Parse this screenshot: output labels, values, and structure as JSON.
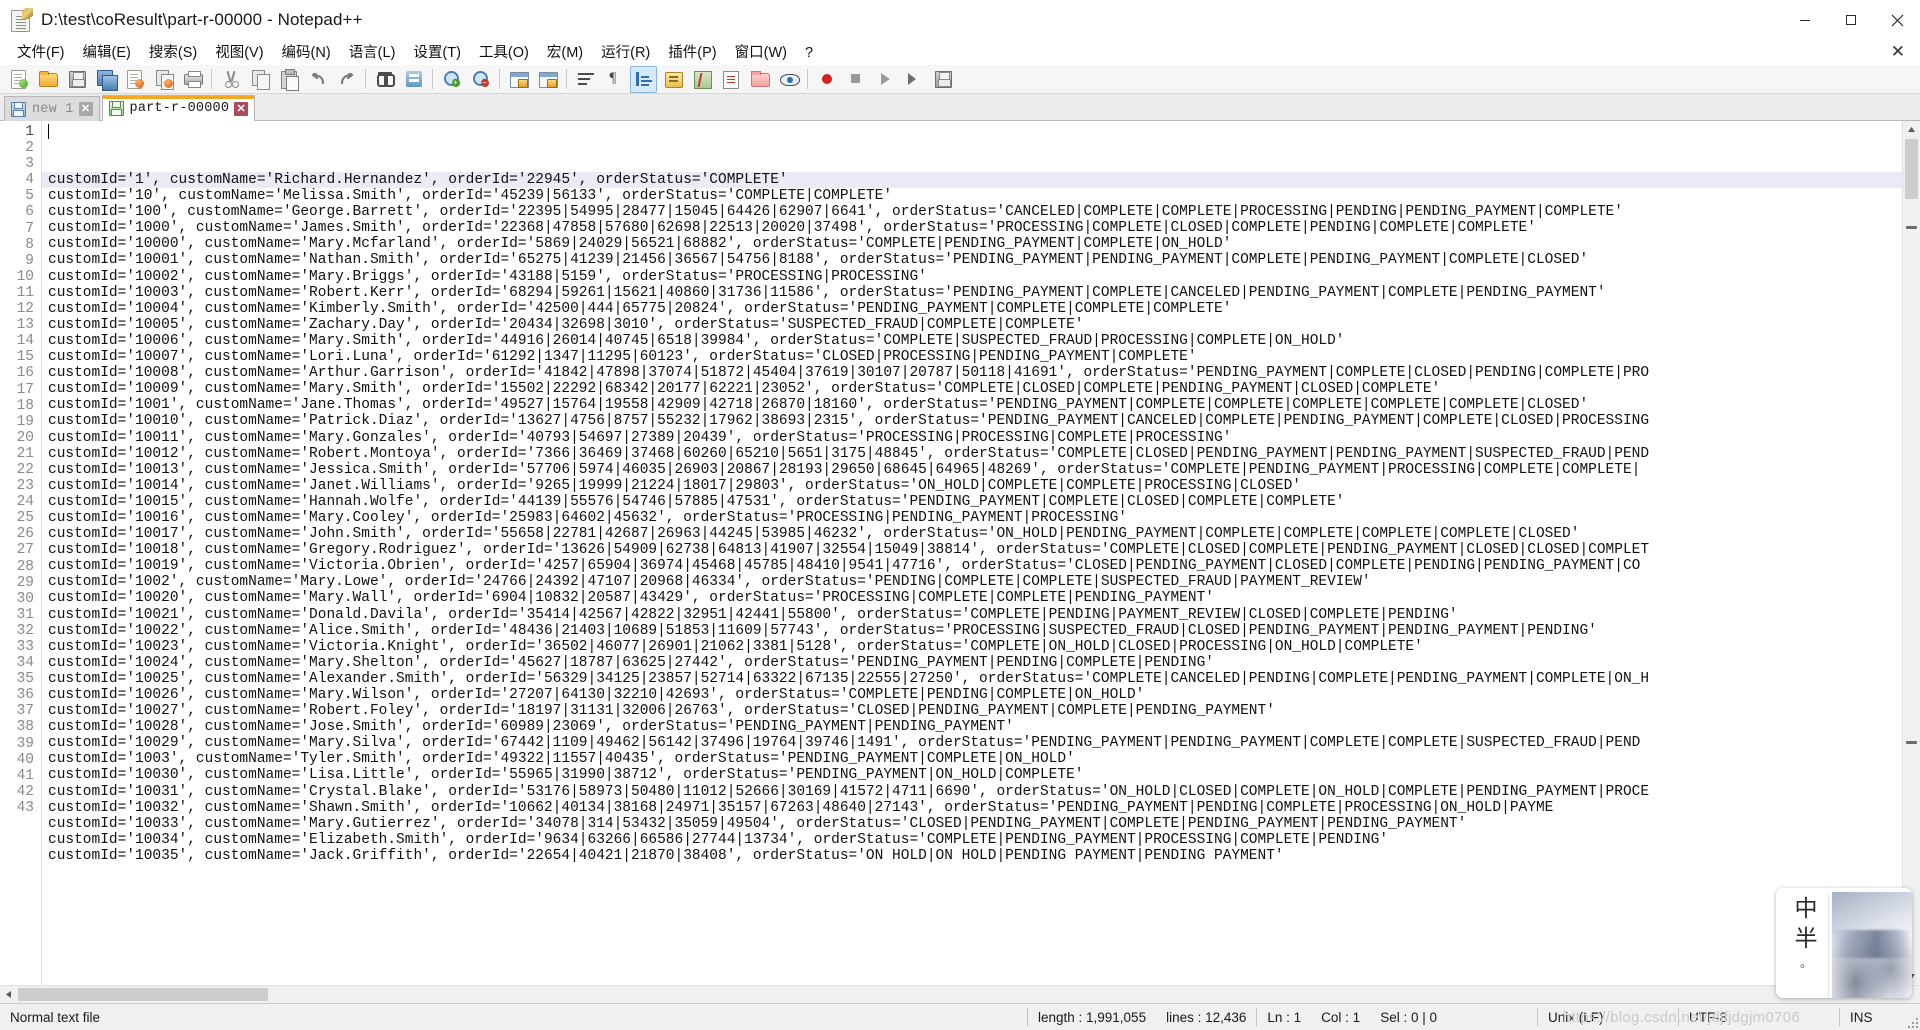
{
  "window": {
    "title": "D:\\test\\coResult\\part-r-00000 - Notepad++",
    "icon": "notepad-plus-plus-icon",
    "minimize_label": "–",
    "maximize_label": "☐",
    "close_label": "✕"
  },
  "menu": {
    "items": [
      {
        "label": "文件(F)",
        "name": "file"
      },
      {
        "label": "编辑(E)",
        "name": "edit"
      },
      {
        "label": "搜索(S)",
        "name": "search"
      },
      {
        "label": "视图(V)",
        "name": "view"
      },
      {
        "label": "编码(N)",
        "name": "encoding"
      },
      {
        "label": "语言(L)",
        "name": "language"
      },
      {
        "label": "设置(T)",
        "name": "settings"
      },
      {
        "label": "工具(O)",
        "name": "tools"
      },
      {
        "label": "宏(M)",
        "name": "macro"
      },
      {
        "label": "运行(R)",
        "name": "run"
      },
      {
        "label": "插件(P)",
        "name": "plugins"
      },
      {
        "label": "窗口(W)",
        "name": "window"
      },
      {
        "label": "?",
        "name": "help"
      }
    ],
    "close_document_label": "✕"
  },
  "toolbar": {
    "buttons": [
      {
        "name": "new-file-icon",
        "title": "新建"
      },
      {
        "name": "open-file-icon",
        "title": "打开"
      },
      {
        "name": "save-icon",
        "title": "保存"
      },
      {
        "name": "save-all-icon",
        "title": "全部保存"
      },
      {
        "name": "close-file-icon",
        "title": "关闭"
      },
      {
        "name": "close-all-icon",
        "title": "全部关闭"
      },
      {
        "name": "print-icon",
        "title": "打印"
      },
      {
        "name": "cut-icon",
        "title": "剪切"
      },
      {
        "name": "copy-icon",
        "title": "复制"
      },
      {
        "name": "paste-icon",
        "title": "粘贴"
      },
      {
        "name": "undo-icon",
        "title": "撤销"
      },
      {
        "name": "redo-icon",
        "title": "重做"
      },
      {
        "name": "find-icon",
        "title": "查找"
      },
      {
        "name": "replace-icon",
        "title": "替换"
      },
      {
        "name": "zoom-in-icon",
        "title": "放大"
      },
      {
        "name": "zoom-out-icon",
        "title": "缩小"
      },
      {
        "name": "sync-vertical-scroll-icon",
        "title": "同步垂直滚动"
      },
      {
        "name": "sync-horizontal-scroll-icon",
        "title": "同步水平滚动"
      },
      {
        "name": "word-wrap-icon",
        "title": "自动换行"
      },
      {
        "name": "show-all-characters-icon",
        "title": "显示所有字符"
      },
      {
        "name": "indent-guide-icon",
        "title": "缩进参考线"
      },
      {
        "name": "user-defined-language-icon",
        "title": "用户自定义语言"
      },
      {
        "name": "document-map-icon",
        "title": "文档地图"
      },
      {
        "name": "function-list-icon",
        "title": "函数列表"
      },
      {
        "name": "folder-as-workspace-icon",
        "title": "文件夹作为工作区"
      },
      {
        "name": "monitoring-icon",
        "title": "监视文件"
      },
      {
        "name": "record-macro-icon",
        "title": "开始录制宏"
      },
      {
        "name": "stop-macro-icon",
        "title": "停止录制宏"
      },
      {
        "name": "play-macro-icon",
        "title": "播放宏"
      },
      {
        "name": "run-macro-multiple-icon",
        "title": "多次运行宏"
      },
      {
        "name": "save-macro-icon",
        "title": "保存当前录制的宏"
      }
    ]
  },
  "tabs": [
    {
      "label": "new 1",
      "active": false,
      "name": "tab-new-1",
      "close_label": "✕"
    },
    {
      "label": "part-r-00000",
      "active": true,
      "name": "tab-part-r-00000",
      "close_label": "✕"
    }
  ],
  "editor": {
    "current_line": 1,
    "first_visible_line": 1,
    "lines": [
      "customId='1', customName='Richard.Hernandez', orderId='22945', orderStatus='COMPLETE'",
      "customId='10', customName='Melissa.Smith', orderId='45239|56133', orderStatus='COMPLETE|COMPLETE'",
      "customId='100', customName='George.Barrett', orderId='22395|54995|28477|15045|64426|62907|6641', orderStatus='CANCELED|COMPLETE|COMPLETE|PROCESSING|PENDING|PENDING_PAYMENT|COMPLETE'",
      "customId='1000', customName='James.Smith', orderId='22368|47858|57680|62698|22513|20020|37498', orderStatus='PROCESSING|COMPLETE|CLOSED|COMPLETE|PENDING|COMPLETE|COMPLETE'",
      "customId='10000', customName='Mary.Mcfarland', orderId='5869|24029|56521|68882', orderStatus='COMPLETE|PENDING_PAYMENT|COMPLETE|ON_HOLD'",
      "customId='10001', customName='Nathan.Smith', orderId='65275|41239|21456|36567|54756|8188', orderStatus='PENDING_PAYMENT|PENDING_PAYMENT|COMPLETE|PENDING_PAYMENT|COMPLETE|CLOSED'",
      "customId='10002', customName='Mary.Briggs', orderId='43188|5159', orderStatus='PROCESSING|PROCESSING'",
      "customId='10003', customName='Robert.Kerr', orderId='68294|59261|15621|40860|31736|11586', orderStatus='PENDING_PAYMENT|COMPLETE|CANCELED|PENDING_PAYMENT|COMPLETE|PENDING_PAYMENT'",
      "customId='10004', customName='Kimberly.Smith', orderId='42500|444|65775|20824', orderStatus='PENDING_PAYMENT|COMPLETE|COMPLETE|COMPLETE'",
      "customId='10005', customName='Zachary.Day', orderId='20434|32698|3010', orderStatus='SUSPECTED_FRAUD|COMPLETE|COMPLETE'",
      "customId='10006', customName='Mary.Smith', orderId='44916|26014|40745|6518|39984', orderStatus='COMPLETE|SUSPECTED_FRAUD|PROCESSING|COMPLETE|ON_HOLD'",
      "customId='10007', customName='Lori.Luna', orderId='61292|1347|11295|60123', orderStatus='CLOSED|PROCESSING|PENDING_PAYMENT|COMPLETE'",
      "customId='10008', customName='Arthur.Garrison', orderId='41842|47898|37074|51872|45404|37619|30107|20787|50118|41691', orderStatus='PENDING_PAYMENT|COMPLETE|CLOSED|PENDING|COMPLETE|PRO",
      "customId='10009', customName='Mary.Smith', orderId='15502|22292|68342|20177|62221|23052', orderStatus='COMPLETE|CLOSED|COMPLETE|PENDING_PAYMENT|CLOSED|COMPLETE'",
      "customId='1001', customName='Jane.Thomas', orderId='49527|15764|19558|42909|42718|26870|18160', orderStatus='PENDING_PAYMENT|COMPLETE|COMPLETE|COMPLETE|COMPLETE|COMPLETE|CLOSED'",
      "customId='10010', customName='Patrick.Diaz', orderId='13627|4756|8757|55232|17962|38693|2315', orderStatus='PENDING_PAYMENT|CANCELED|COMPLETE|PENDING_PAYMENT|COMPLETE|CLOSED|PROCESSING",
      "customId='10011', customName='Mary.Gonzales', orderId='40793|54697|27389|20439', orderStatus='PROCESSING|PROCESSING|COMPLETE|PROCESSING'",
      "customId='10012', customName='Robert.Montoya', orderId='7366|36469|37468|60260|65210|5651|3175|48845', orderStatus='COMPLETE|CLOSED|PENDING_PAYMENT|PENDING_PAYMENT|SUSPECTED_FRAUD|PEND",
      "customId='10013', customName='Jessica.Smith', orderId='57706|5974|46035|26903|20867|28193|29650|68645|64965|48269', orderStatus='COMPLETE|PENDING_PAYMENT|PROCESSING|COMPLETE|COMPLETE|",
      "customId='10014', customName='Janet.Williams', orderId='9265|19999|21224|18017|29803', orderStatus='ON_HOLD|COMPLETE|COMPLETE|PROCESSING|CLOSED'",
      "customId='10015', customName='Hannah.Wolfe', orderId='44139|55576|54746|57885|47531', orderStatus='PENDING_PAYMENT|COMPLETE|CLOSED|COMPLETE|COMPLETE'",
      "customId='10016', customName='Mary.Cooley', orderId='25983|64602|45632', orderStatus='PROCESSING|PENDING_PAYMENT|PROCESSING'",
      "customId='10017', customName='John.Smith', orderId='55658|22781|42687|26963|44245|53985|46232', orderStatus='ON_HOLD|PENDING_PAYMENT|COMPLETE|COMPLETE|COMPLETE|COMPLETE|CLOSED'",
      "customId='10018', customName='Gregory.Rodriguez', orderId='13626|54909|62738|64813|41907|32554|15049|38814', orderStatus='COMPLETE|CLOSED|COMPLETE|PENDING_PAYMENT|CLOSED|CLOSED|COMPLET",
      "customId='10019', customName='Victoria.Obrien', orderId='4257|65904|36974|45468|45785|48410|9541|47716', orderStatus='CLOSED|PENDING_PAYMENT|CLOSED|COMPLETE|PENDING|PENDING_PAYMENT|CO",
      "customId='1002', customName='Mary.Lowe', orderId='24766|24392|47107|20968|46334', orderStatus='PENDING|COMPLETE|COMPLETE|SUSPECTED_FRAUD|PAYMENT_REVIEW'",
      "customId='10020', customName='Mary.Wall', orderId='6904|10832|20587|43429', orderStatus='PROCESSING|COMPLETE|COMPLETE|PENDING_PAYMENT'",
      "customId='10021', customName='Donald.Davila', orderId='35414|42567|42822|32951|42441|55800', orderStatus='COMPLETE|PENDING|PAYMENT_REVIEW|CLOSED|COMPLETE|PENDING'",
      "customId='10022', customName='Alice.Smith', orderId='48436|21403|10689|51853|11609|57743', orderStatus='PROCESSING|SUSPECTED_FRAUD|CLOSED|PENDING_PAYMENT|PENDING_PAYMENT|PENDING'",
      "customId='10023', customName='Victoria.Knight', orderId='36502|46077|26901|21062|3381|5128', orderStatus='COMPLETE|ON_HOLD|CLOSED|PROCESSING|ON_HOLD|COMPLETE'",
      "customId='10024', customName='Mary.Shelton', orderId='45627|18787|63625|27442', orderStatus='PENDING_PAYMENT|PENDING|COMPLETE|PENDING'",
      "customId='10025', customName='Alexander.Smith', orderId='56329|34125|23857|52714|63322|67135|22555|27250', orderStatus='COMPLETE|CANCELED|PENDING|COMPLETE|PENDING_PAYMENT|COMPLETE|ON_H",
      "customId='10026', customName='Mary.Wilson', orderId='27207|64130|32210|42693', orderStatus='COMPLETE|PENDING|COMPLETE|ON_HOLD'",
      "customId='10027', customName='Robert.Foley', orderId='18197|31131|32006|26763', orderStatus='CLOSED|PENDING_PAYMENT|COMPLETE|PENDING_PAYMENT'",
      "customId='10028', customName='Jose.Smith', orderId='60989|23069', orderStatus='PENDING_PAYMENT|PENDING_PAYMENT'",
      "customId='10029', customName='Mary.Silva', orderId='67442|1109|49462|56142|37496|19764|39746|1491', orderStatus='PENDING_PAYMENT|PENDING_PAYMENT|COMPLETE|COMPLETE|SUSPECTED_FRAUD|PEND",
      "customId='1003', customName='Tyler.Smith', orderId='49322|11557|40435', orderStatus='PENDING_PAYMENT|COMPLETE|ON_HOLD'",
      "customId='10030', customName='Lisa.Little', orderId='55965|31990|38712', orderStatus='PENDING_PAYMENT|ON_HOLD|COMPLETE'",
      "customId='10031', customName='Crystal.Blake', orderId='53176|58973|50480|11012|52666|30169|41572|4711|6690', orderStatus='ON_HOLD|CLOSED|COMPLETE|ON_HOLD|COMPLETE|PENDING_PAYMENT|PROCE",
      "customId='10032', customName='Shawn.Smith', orderId='10662|40134|38168|24971|35157|67263|48640|27143', orderStatus='PENDING_PAYMENT|PENDING|COMPLETE|PROCESSING|ON_HOLD|PAYME",
      "customId='10033', customName='Mary.Gutierrez', orderId='34078|314|53432|35059|49504', orderStatus='CLOSED|PENDING_PAYMENT|COMPLETE|PENDING_PAYMENT|PENDING_PAYMENT'",
      "customId='10034', customName='Elizabeth.Smith', orderId='9634|63266|66586|27744|13734', orderStatus='COMPLETE|PENDING_PAYMENT|PROCESSING|COMPLETE|PENDING'",
      "customId='10035', customName='Jack.Griffith', orderId='22654|40421|21870|38408', orderStatus='ON HOLD|ON HOLD|PENDING PAYMENT|PENDING PAYMENT'"
    ]
  },
  "statusbar": {
    "file_type": "Normal text file",
    "length_label": "length : 1,991,055",
    "lines_label": "lines : 12,436",
    "ln_label": "Ln : 1",
    "col_label": "Col : 1",
    "sel_label": "Sel : 0 | 0",
    "eol": "Unix (LF)",
    "encoding": "UTF-8",
    "insert_mode": "INS"
  },
  "overlay": {
    "watermark": "https://blog.csdn.net/jdjfjdgjm0706",
    "image_characters": [
      "中",
      "半",
      "。"
    ]
  },
  "colors": {
    "active_tab_accent": "#f5a623",
    "current_line_highlight": "#eceaf7",
    "window_bg": "#f0f0f0",
    "editor_bg": "#ffffff",
    "gutter_text": "#8a8a8a",
    "close_hover": "#e81123"
  }
}
